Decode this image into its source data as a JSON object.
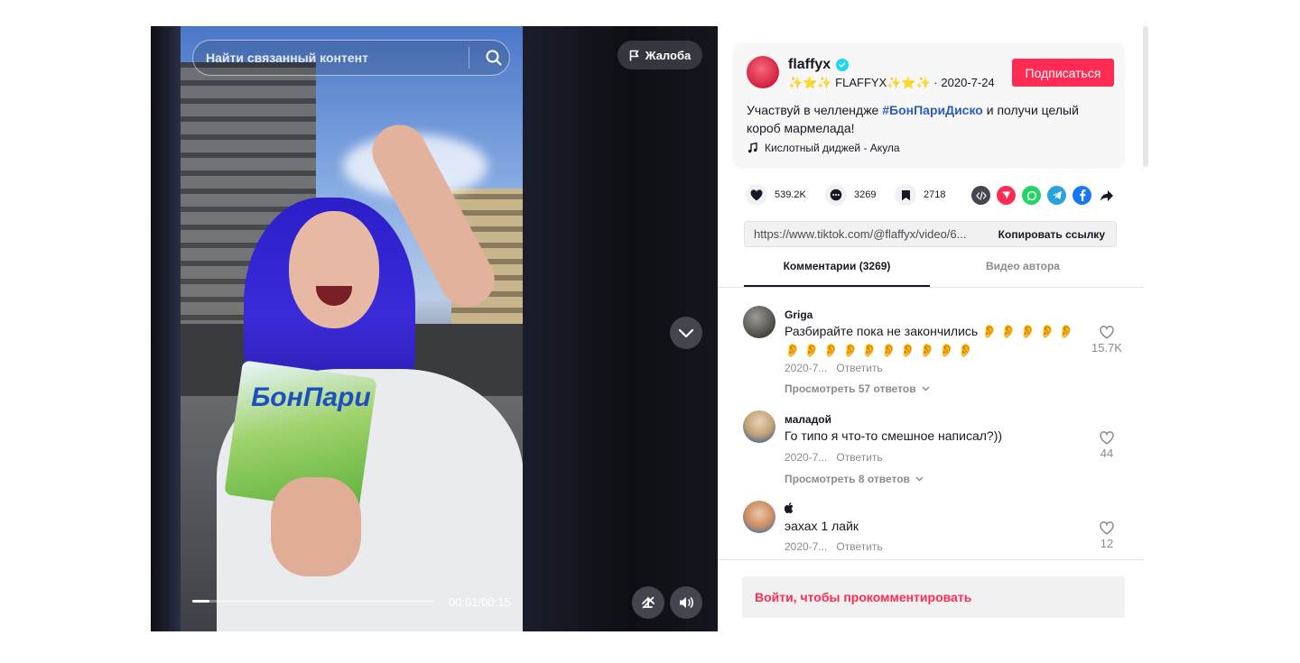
{
  "video": {
    "search_placeholder": "Найти связанный контент",
    "report_label": "Жалоба",
    "time_current": "00:01",
    "time_total": "00:15",
    "time_separator": "/",
    "progress_fraction": 0.07,
    "pack_brand": "БонПари"
  },
  "author": {
    "name": "flaffyx",
    "nickname": "✨⭐✨ FLAFFYX✨⭐✨",
    "separator": "·",
    "date": "2020-7-24",
    "follow_label": "Подписаться"
  },
  "description": {
    "before": "Участвуй в челлендже ",
    "hashtag": "#БонПариДиско",
    "after": " и получи целый короб мармелада!",
    "music": "Кислотный диджей - Акула"
  },
  "stats": {
    "likes": "539.2K",
    "comments": "3269",
    "saves": "2718"
  },
  "share": {
    "icons": [
      "embed-icon",
      "share-red-icon",
      "whatsapp-icon",
      "telegram-icon",
      "facebook-icon",
      "forward-icon"
    ]
  },
  "link": {
    "url": "https://www.tiktok.com/@flaffyx/video/6...",
    "copy_label": "Копировать ссылку"
  },
  "tabs": [
    {
      "label": "Комментарии (3269)"
    },
    {
      "label": "Видео автора"
    }
  ],
  "comments": [
    {
      "user": "Griga",
      "text": "Разбирайте пока не закончились 👂 👂 👂 👂 👂 👂 👂 👂 👂 👂 👂 👂 👂 👂 👂",
      "date": "2020-7...",
      "reply": "Ответить",
      "more": "Просмотреть 57 ответов",
      "likes": "15.7K"
    },
    {
      "user": "маладой",
      "text": "Го типо я что-то смешное написал?))",
      "date": "2020-7...",
      "reply": "Ответить",
      "more": "Просмотреть 8 ответов",
      "likes": "44"
    },
    {
      "user": "",
      "text": "эахах 1 лайк",
      "date": "2020-7...",
      "reply": "Ответить",
      "likes": "12"
    }
  ],
  "login_prompt": "Войти, чтобы прокомментировать",
  "colors": {
    "accent": "#fe2c55",
    "hashtag": "#2b5db9",
    "verified": "#20d5ec"
  }
}
